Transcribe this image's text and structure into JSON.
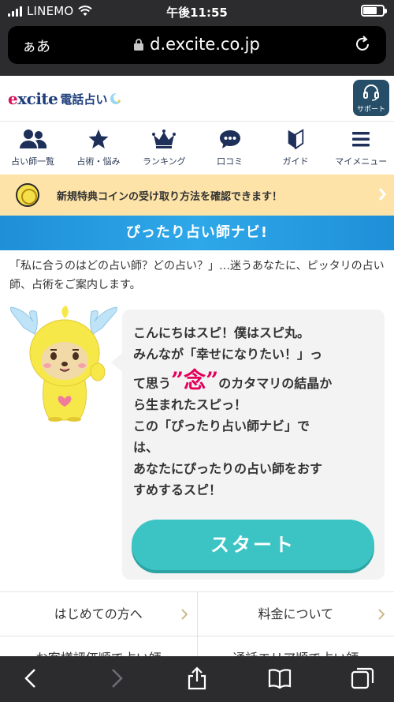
{
  "status_bar": {
    "carrier": "LINEMO",
    "time": "午後11:55"
  },
  "url_bar": {
    "text_size": "ぁあ",
    "domain": "d.excite.co.jp"
  },
  "header": {
    "logo_brand": "excite",
    "logo_service": "電話占い",
    "support_label": "サポート"
  },
  "nav": [
    {
      "label": "占い師一覧",
      "icon": "users-icon"
    },
    {
      "label": "占術・悩み",
      "icon": "star-icon"
    },
    {
      "label": "ランキング",
      "icon": "crown-icon"
    },
    {
      "label": "口コミ",
      "icon": "chat-icon"
    },
    {
      "label": "ガイド",
      "icon": "guide-icon"
    },
    {
      "label": "マイメニュー",
      "icon": "menu-icon"
    }
  ],
  "notice": {
    "text": "新規特典コインの受け取り方法を確認できます！"
  },
  "banner": {
    "title": "ぴったり占い師ナビ!"
  },
  "intro": {
    "text": "「私に合うのはどの占い師？どの占い？」…迷うあなたに、ピッタリの占い師、占術をご案内します。"
  },
  "bubble": {
    "line1": "こんにちはスピ！僕はスピ丸。",
    "line2": "みんなが「幸せになりたい！」っ",
    "line3_pre": "て思う",
    "line3_em": "”念”",
    "line3_post": "のカタマリの結晶か",
    "line4": "ら生まれたスピっ！",
    "line5": "この「ぴったり占い師ナビ」で",
    "line6": "は、",
    "line7": "あなたにぴったりの占い師をおす",
    "line8": "すめするスピ！",
    "start_label": "スタート"
  },
  "links": [
    [
      "はじめての方へ",
      "料金について"
    ],
    [
      "お客様評価順で占い師",
      "通話エリア順で占い師"
    ]
  ],
  "colors": {
    "banner": "#2ea8e8",
    "start_button": "#3cc4c4",
    "notice_bg": "#fde3a7",
    "nav_icon": "#1e2f5a"
  }
}
